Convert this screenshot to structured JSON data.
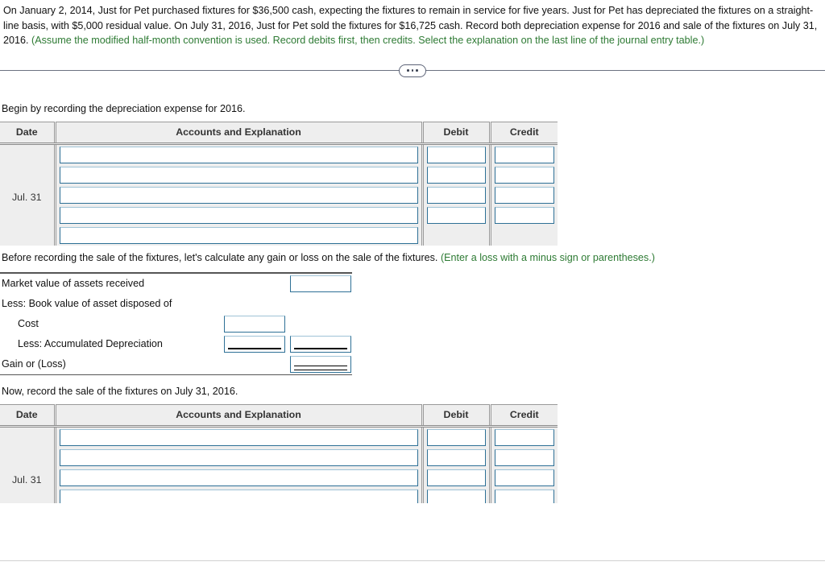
{
  "problem": {
    "text_before_hint": "On January 2, 2014, Just for Pet purchased fixtures for $36,500 cash, expecting the fixtures to remain in service for five years.  Just for Pet has depreciated the fixtures on a straight-line basis, with $5,000 residual value. On July 31, 2016, Just for Pet sold the fixtures for $16,725 cash. Record both depreciation expense for 2016 and sale of the fixtures on July 31, 2016. ",
    "hint": "(Assume the modified half-month convention is used. Record debits first, then credits. Select the explanation on the last line of the journal entry table.)",
    "purchase_date": "January 2, 2014",
    "cost": "$36,500",
    "useful_life": "five years",
    "residual_value": "$5,000",
    "sale_date": "July 31, 2016",
    "sale_price": "$16,725"
  },
  "divider": {
    "icon": "ellipsis-icon",
    "dots": 3
  },
  "section1": {
    "prompt": "Begin by recording the depreciation expense for 2016.",
    "table": {
      "headers": [
        "Date",
        "Accounts and Explanation",
        "Debit",
        "Credit"
      ],
      "date_value": "Jul. 31",
      "row_count": 5,
      "rows": [
        {
          "account": "",
          "debit": "",
          "credit": "",
          "has_debit": true,
          "has_credit": true
        },
        {
          "account": "",
          "debit": "",
          "credit": "",
          "has_debit": true,
          "has_credit": true
        },
        {
          "account": "",
          "debit": "",
          "credit": "",
          "has_debit": true,
          "has_credit": true
        },
        {
          "account": "",
          "debit": "",
          "credit": "",
          "has_debit": true,
          "has_credit": true
        },
        {
          "account": "",
          "debit": "",
          "credit": "",
          "has_debit": false,
          "has_credit": false
        }
      ]
    }
  },
  "section2": {
    "prompt_text": "Before recording the sale of the fixtures, let's calculate any gain or loss on the sale of the fixtures. ",
    "prompt_hint": "(Enter a loss with a minus sign or parentheses.)",
    "schedule": {
      "rows": [
        {
          "label": "Market value of assets received",
          "indent": false,
          "value_b": "",
          "has_b": true,
          "has_a": false,
          "rule": "none"
        },
        {
          "label": "Less: Book value of asset disposed of",
          "indent": false,
          "has_a": false,
          "has_b": false,
          "rule": "none"
        },
        {
          "label": "Cost",
          "indent": true,
          "value_a": "",
          "has_a": true,
          "has_b": false,
          "rule": "none"
        },
        {
          "label": "Less: Accumulated Depreciation",
          "indent": true,
          "value_a": "",
          "value_b": "",
          "has_a": true,
          "has_b": true,
          "rule": "single"
        },
        {
          "label": "Gain or (Loss)",
          "indent": false,
          "value_b": "",
          "has_a": false,
          "has_b": true,
          "rule": "double"
        }
      ]
    }
  },
  "section3": {
    "prompt": "Now, record the sale of the fixtures on July 31, 2016.",
    "table": {
      "headers": [
        "Date",
        "Accounts and Explanation",
        "Debit",
        "Credit"
      ],
      "date_value": "Jul. 31",
      "row_count": 5,
      "rows": [
        {
          "account": "",
          "debit": "",
          "credit": "",
          "has_debit": true,
          "has_credit": true
        },
        {
          "account": "",
          "debit": "",
          "credit": "",
          "has_debit": true,
          "has_credit": true
        },
        {
          "account": "",
          "debit": "",
          "credit": "",
          "has_debit": true,
          "has_credit": true
        },
        {
          "account": "",
          "debit": "",
          "credit": "",
          "has_debit": true,
          "has_credit": true
        },
        {
          "account": "",
          "debit": "",
          "credit": "",
          "has_debit": false,
          "has_credit": false
        }
      ]
    }
  },
  "colors": {
    "hint_green": "#2d7a33",
    "input_border": "#2e7096",
    "table_bg": "#eeeeee",
    "rule_dark": "#555555"
  }
}
